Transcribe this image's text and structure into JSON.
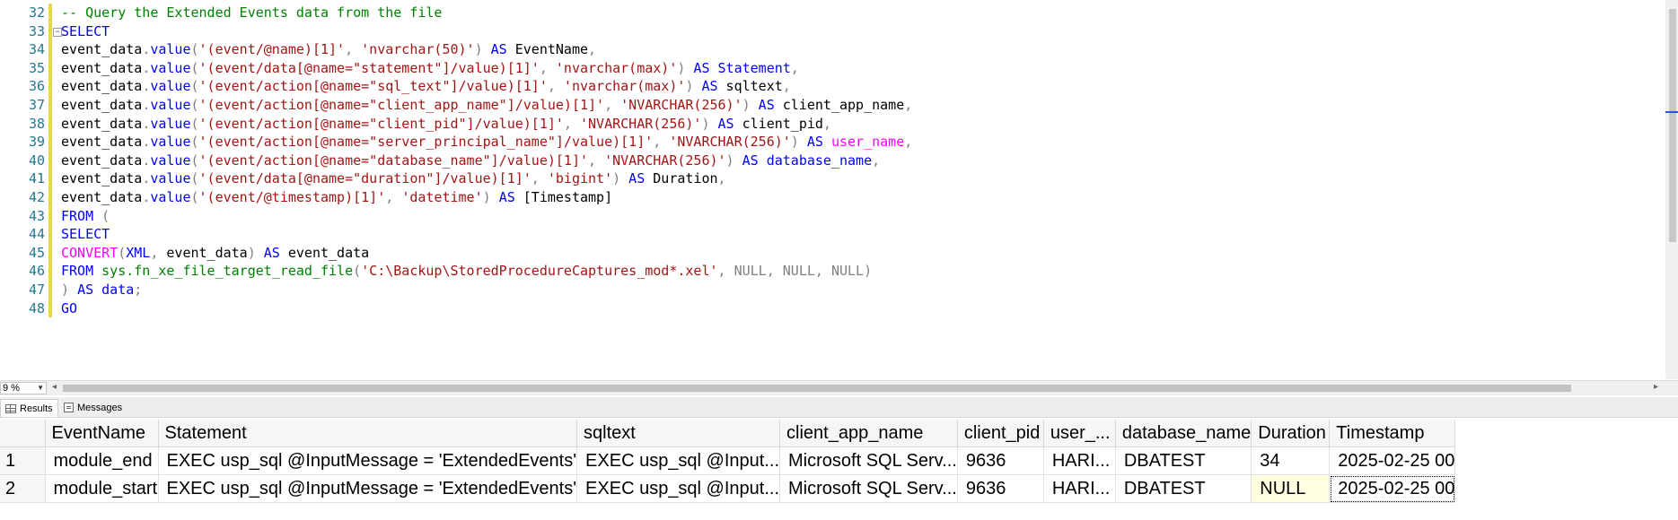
{
  "editor": {
    "lines": [
      {
        "num": "32",
        "tokens": [
          {
            "t": "-- Query the Extended Events data from the file",
            "c": "cm"
          }
        ]
      },
      {
        "num": "33",
        "tokens": [
          {
            "t": "SELECT",
            "c": "kw"
          }
        ]
      },
      {
        "num": "34",
        "tokens": [
          {
            "t": "event_data",
            "c": "txt"
          },
          {
            "t": ".",
            "c": "gray"
          },
          {
            "t": "value",
            "c": "kw"
          },
          {
            "t": "(",
            "c": "gray"
          },
          {
            "t": "'(event/@name)[1]'",
            "c": "str"
          },
          {
            "t": ", ",
            "c": "gray"
          },
          {
            "t": "'nvarchar(50)'",
            "c": "str"
          },
          {
            "t": ") ",
            "c": "gray"
          },
          {
            "t": "AS",
            "c": "kw"
          },
          {
            "t": " EventName",
            "c": "txt"
          },
          {
            "t": ",",
            "c": "gray"
          }
        ]
      },
      {
        "num": "35",
        "tokens": [
          {
            "t": "event_data",
            "c": "txt"
          },
          {
            "t": ".",
            "c": "gray"
          },
          {
            "t": "value",
            "c": "kw"
          },
          {
            "t": "(",
            "c": "gray"
          },
          {
            "t": "'(event/data[@name=\"statement\"]/value)[1]'",
            "c": "str"
          },
          {
            "t": ", ",
            "c": "gray"
          },
          {
            "t": "'nvarchar(max)'",
            "c": "str"
          },
          {
            "t": ") ",
            "c": "gray"
          },
          {
            "t": "AS",
            "c": "kw"
          },
          {
            "t": " ",
            "c": "txt"
          },
          {
            "t": "Statement",
            "c": "kw"
          },
          {
            "t": ",",
            "c": "gray"
          }
        ]
      },
      {
        "num": "36",
        "tokens": [
          {
            "t": "event_data",
            "c": "txt"
          },
          {
            "t": ".",
            "c": "gray"
          },
          {
            "t": "value",
            "c": "kw"
          },
          {
            "t": "(",
            "c": "gray"
          },
          {
            "t": "'(event/action[@name=\"sql_text\"]/value)[1]'",
            "c": "str"
          },
          {
            "t": ", ",
            "c": "gray"
          },
          {
            "t": "'nvarchar(max)'",
            "c": "str"
          },
          {
            "t": ") ",
            "c": "gray"
          },
          {
            "t": "AS",
            "c": "kw"
          },
          {
            "t": " sqltext",
            "c": "txt"
          },
          {
            "t": ",",
            "c": "gray"
          }
        ]
      },
      {
        "num": "37",
        "tokens": [
          {
            "t": "event_data",
            "c": "txt"
          },
          {
            "t": ".",
            "c": "gray"
          },
          {
            "t": "value",
            "c": "kw"
          },
          {
            "t": "(",
            "c": "gray"
          },
          {
            "t": "'(event/action[@name=\"client_app_name\"]/value)[1]'",
            "c": "str"
          },
          {
            "t": ", ",
            "c": "gray"
          },
          {
            "t": "'NVARCHAR(256)'",
            "c": "str"
          },
          {
            "t": ") ",
            "c": "gray"
          },
          {
            "t": "AS",
            "c": "kw"
          },
          {
            "t": " client_app_name",
            "c": "txt"
          },
          {
            "t": ",",
            "c": "gray"
          }
        ]
      },
      {
        "num": "38",
        "tokens": [
          {
            "t": "event_data",
            "c": "txt"
          },
          {
            "t": ".",
            "c": "gray"
          },
          {
            "t": "value",
            "c": "kw"
          },
          {
            "t": "(",
            "c": "gray"
          },
          {
            "t": "'(event/action[@name=\"client_pid\"]/value)[1]'",
            "c": "str"
          },
          {
            "t": ", ",
            "c": "gray"
          },
          {
            "t": "'NVARCHAR(256)'",
            "c": "str"
          },
          {
            "t": ") ",
            "c": "gray"
          },
          {
            "t": "AS",
            "c": "kw"
          },
          {
            "t": " client_pid",
            "c": "txt"
          },
          {
            "t": ",",
            "c": "gray"
          }
        ]
      },
      {
        "num": "39",
        "tokens": [
          {
            "t": "event_data",
            "c": "txt"
          },
          {
            "t": ".",
            "c": "gray"
          },
          {
            "t": "value",
            "c": "kw"
          },
          {
            "t": "(",
            "c": "gray"
          },
          {
            "t": "'(event/action[@name=\"server_principal_name\"]/value)[1]'",
            "c": "str"
          },
          {
            "t": ", ",
            "c": "gray"
          },
          {
            "t": "'NVARCHAR(256)'",
            "c": "str"
          },
          {
            "t": ") ",
            "c": "gray"
          },
          {
            "t": "AS",
            "c": "kw"
          },
          {
            "t": " ",
            "c": "txt"
          },
          {
            "t": "user_name",
            "c": "fn"
          },
          {
            "t": ",",
            "c": "gray"
          }
        ]
      },
      {
        "num": "40",
        "tokens": [
          {
            "t": "event_data",
            "c": "txt"
          },
          {
            "t": ".",
            "c": "gray"
          },
          {
            "t": "value",
            "c": "kw"
          },
          {
            "t": "(",
            "c": "gray"
          },
          {
            "t": "'(event/action[@name=\"database_name\"]/value)[1]'",
            "c": "str"
          },
          {
            "t": ", ",
            "c": "gray"
          },
          {
            "t": "'NVARCHAR(256)'",
            "c": "str"
          },
          {
            "t": ") ",
            "c": "gray"
          },
          {
            "t": "AS",
            "c": "kw"
          },
          {
            "t": " ",
            "c": "txt"
          },
          {
            "t": "database_name",
            "c": "kw"
          },
          {
            "t": ",",
            "c": "gray"
          }
        ]
      },
      {
        "num": "41",
        "tokens": [
          {
            "t": "event_data",
            "c": "txt"
          },
          {
            "t": ".",
            "c": "gray"
          },
          {
            "t": "value",
            "c": "kw"
          },
          {
            "t": "(",
            "c": "gray"
          },
          {
            "t": "'(event/data[@name=\"duration\"]/value)[1]'",
            "c": "str"
          },
          {
            "t": ", ",
            "c": "gray"
          },
          {
            "t": "'bigint'",
            "c": "str"
          },
          {
            "t": ") ",
            "c": "gray"
          },
          {
            "t": "AS",
            "c": "kw"
          },
          {
            "t": " Duration",
            "c": "txt"
          },
          {
            "t": ",",
            "c": "gray"
          }
        ]
      },
      {
        "num": "42",
        "tokens": [
          {
            "t": "event_data",
            "c": "txt"
          },
          {
            "t": ".",
            "c": "gray"
          },
          {
            "t": "value",
            "c": "kw"
          },
          {
            "t": "(",
            "c": "gray"
          },
          {
            "t": "'(event/@timestamp)[1]'",
            "c": "str"
          },
          {
            "t": ", ",
            "c": "gray"
          },
          {
            "t": "'datetime'",
            "c": "str"
          },
          {
            "t": ") ",
            "c": "gray"
          },
          {
            "t": "AS",
            "c": "kw"
          },
          {
            "t": " [Timestamp]",
            "c": "txt"
          }
        ]
      },
      {
        "num": "43",
        "tokens": [
          {
            "t": "FROM",
            "c": "kw"
          },
          {
            "t": " (",
            "c": "gray"
          }
        ]
      },
      {
        "num": "44",
        "tokens": [
          {
            "t": "SELECT",
            "c": "kw"
          }
        ]
      },
      {
        "num": "45",
        "tokens": [
          {
            "t": "CONVERT",
            "c": "fn"
          },
          {
            "t": "(",
            "c": "gray"
          },
          {
            "t": "XML",
            "c": "kw"
          },
          {
            "t": ",",
            "c": "gray"
          },
          {
            "t": " event_data",
            "c": "txt"
          },
          {
            "t": ") ",
            "c": "gray"
          },
          {
            "t": "AS",
            "c": "kw"
          },
          {
            "t": " event_data",
            "c": "txt"
          }
        ]
      },
      {
        "num": "46",
        "tokens": [
          {
            "t": "FROM",
            "c": "kw"
          },
          {
            "t": " ",
            "c": "txt"
          },
          {
            "t": "sys.fn_xe_file_target_read_file",
            "c": "sys"
          },
          {
            "t": "(",
            "c": "gray"
          },
          {
            "t": "'C:\\Backup\\StoredProcedureCaptures_mod*.xel'",
            "c": "str"
          },
          {
            "t": ", ",
            "c": "gray"
          },
          {
            "t": "NULL",
            "c": "null"
          },
          {
            "t": ", ",
            "c": "gray"
          },
          {
            "t": "NULL",
            "c": "null"
          },
          {
            "t": ", ",
            "c": "gray"
          },
          {
            "t": "NULL",
            "c": "null"
          },
          {
            "t": ")",
            "c": "gray"
          }
        ]
      },
      {
        "num": "47",
        "tokens": [
          {
            "t": ") ",
            "c": "gray"
          },
          {
            "t": "AS",
            "c": "kw"
          },
          {
            "t": " ",
            "c": "txt"
          },
          {
            "t": "data",
            "c": "kw"
          },
          {
            "t": ";",
            "c": "gray"
          }
        ]
      },
      {
        "num": "48",
        "tokens": [
          {
            "t": "GO",
            "c": "kw"
          }
        ]
      }
    ]
  },
  "statusbar": {
    "zoom": "9 %"
  },
  "results": {
    "tabs": {
      "results_label": "Results",
      "messages_label": "Messages"
    },
    "columns": [
      "",
      "EventName",
      "Statement",
      "sqltext",
      "client_app_name",
      "client_pid",
      "user_...",
      "database_name",
      "Duration",
      "Timestamp"
    ],
    "rows": [
      {
        "cells": [
          "1",
          "module_end",
          "EXEC usp_sql @InputMessage = 'ExtendedEvents'",
          "EXEC usp_sql @Input...",
          "Microsoft SQL Serv...",
          "9636",
          "HARI...",
          "DBATEST",
          "34",
          "2025-02-25 00"
        ]
      },
      {
        "cells": [
          "2",
          "module_start",
          "EXEC usp_sql @InputMessage = 'ExtendedEvents'",
          "EXEC usp_sql @Input...",
          "Microsoft SQL Serv...",
          "9636",
          "HARI...",
          "DBATEST",
          "NULL",
          "2025-02-25 00"
        ]
      }
    ]
  },
  "colors": {
    "keyword": "#0000ff",
    "string": "#a31515",
    "comment": "#008000",
    "function": "#ff00ff",
    "line_number": "#237893",
    "change_bar": "#e6d84a",
    "null_cell": "#ffffe1"
  }
}
